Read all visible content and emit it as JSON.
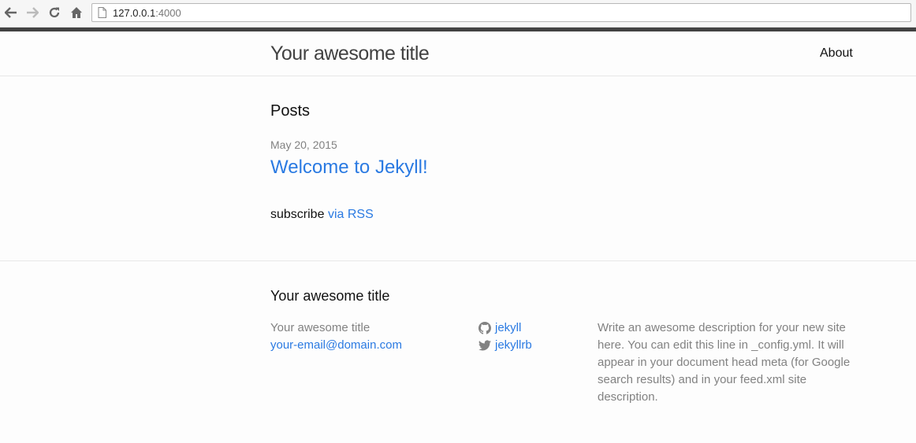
{
  "browser": {
    "url_host": "127.0.0.1",
    "url_port": ":4000"
  },
  "header": {
    "site_title": "Your awesome title",
    "nav": [
      {
        "label": "About"
      }
    ]
  },
  "main": {
    "posts_heading": "Posts",
    "posts": [
      {
        "date": "May 20, 2015",
        "title": "Welcome to Jekyll!"
      }
    ],
    "subscribe_text": "subscribe",
    "rss_link_label": "via RSS"
  },
  "footer": {
    "heading": "Your awesome title",
    "contact_name": "Your awesome title",
    "email": "your-email@domain.com",
    "social": [
      {
        "icon": "github-icon",
        "label": "jekyll"
      },
      {
        "icon": "twitter-icon",
        "label": "jekyllrb"
      }
    ],
    "description": "Write an awesome description for your new site here. You can edit this line in _config.yml. It will appear in your document head meta (for Google search results) and in your feed.xml site description."
  },
  "colors": {
    "link": "#2a7ae2",
    "meta_grey": "#828282",
    "title_dark": "#424242"
  }
}
